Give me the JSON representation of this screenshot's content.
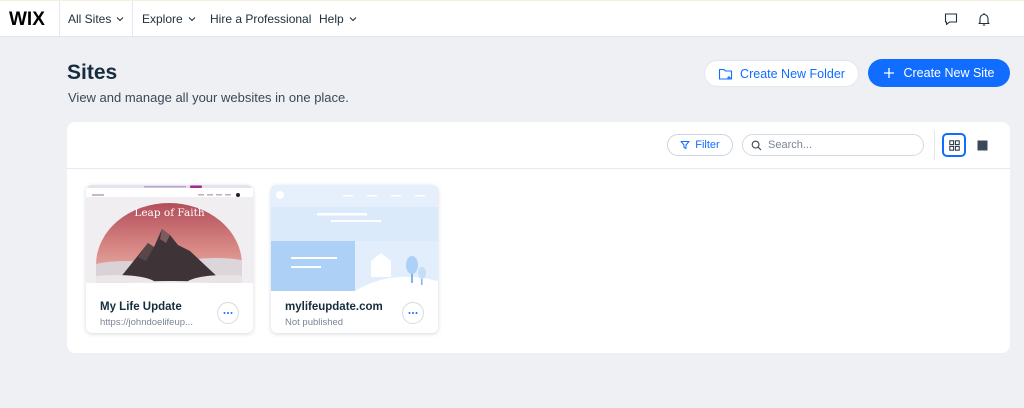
{
  "topbar": {
    "logo": "WIX",
    "nav": [
      {
        "label": "All Sites",
        "has_dropdown": true
      },
      {
        "label": "Explore",
        "has_dropdown": true
      },
      {
        "label": "Hire a Professional",
        "has_dropdown": false
      },
      {
        "label": "Help",
        "has_dropdown": true
      }
    ],
    "icons": [
      "chat-icon",
      "bell-icon"
    ]
  },
  "header": {
    "title": "Sites",
    "subtitle": "View and manage all your websites in one place.",
    "create_folder_label": "Create New Folder",
    "create_site_label": "Create New Site"
  },
  "toolbar": {
    "filter_label": "Filter",
    "search_placeholder": "Search...",
    "active_view": "grid"
  },
  "sites": [
    {
      "name": "My Life Update",
      "subtitle": "https://johndoelifeup...",
      "thumbnail_text": "Leap of Faith"
    },
    {
      "name": "mylifeupdate.com",
      "subtitle": "Not published"
    }
  ],
  "colors": {
    "accent": "#116dff",
    "background": "#eef0f4",
    "text_dark": "#162d3d"
  }
}
